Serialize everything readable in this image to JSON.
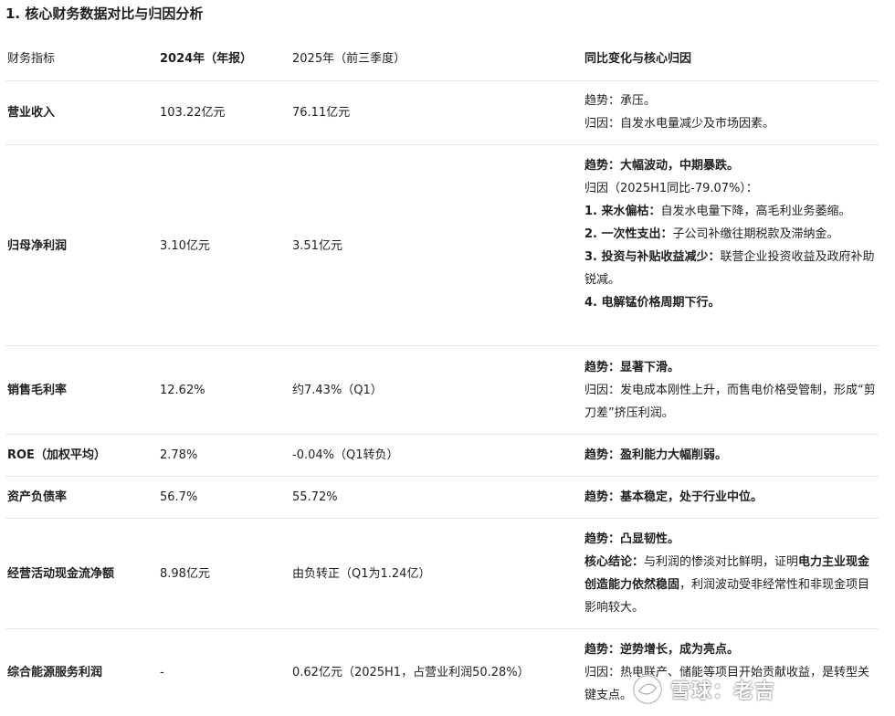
{
  "title": "1. 核心财务数据对比与归因分析",
  "headers": [
    "财务指标",
    "2024年（年报）",
    "2025年（前三季度）",
    "同比变化与核心归因"
  ],
  "rows": [
    {
      "metric": "营业收入",
      "y2024": "103.22亿元",
      "y2025": "76.11亿元",
      "analysis": [
        {
          "segments": [
            {
              "text": "趋势：承压。",
              "bold": false
            }
          ]
        },
        {
          "segments": [
            {
              "text": "归因：自发水电量减少及市场因素。",
              "bold": false
            }
          ]
        }
      ]
    },
    {
      "metric": "归母净利润",
      "y2024": "3.10亿元",
      "y2025": "3.51亿元",
      "analysis": [
        {
          "segments": [
            {
              "text": "趋势：大幅波动，中期暴跌。",
              "bold": true
            }
          ]
        },
        {
          "segments": [
            {
              "text": "归因（2025H1同比-79.07%）：",
              "bold": false
            }
          ]
        },
        {
          "segments": [
            {
              "text": "1. 来水偏枯：",
              "bold": true
            },
            {
              "text": "自发水电量下降，高毛利业务萎缩。",
              "bold": false
            }
          ]
        },
        {
          "segments": [
            {
              "text": "2. 一次性支出：",
              "bold": true
            },
            {
              "text": "子公司补缴往期税款及滞纳金。",
              "bold": false
            }
          ]
        },
        {
          "segments": [
            {
              "text": "3. 投资与补贴收益减少：",
              "bold": true
            },
            {
              "text": "联营企业投资收益及政府补助锐减。",
              "bold": false
            }
          ]
        },
        {
          "segments": [
            {
              "text": "4. 电解锰价格周期下行。",
              "bold": true
            }
          ]
        }
      ]
    },
    {
      "metric": "销售毛利率",
      "y2024": "12.62%",
      "y2025": "约7.43%（Q1）",
      "analysis": [
        {
          "segments": [
            {
              "text": "趋势：显著下滑。",
              "bold": true
            }
          ]
        },
        {
          "segments": [
            {
              "text": "归因：发电成本刚性上升，而售电价格受管制，形成“剪刀差”挤压利润。",
              "bold": false
            }
          ]
        }
      ]
    },
    {
      "metric": "ROE（加权平均）",
      "y2024": "2.78%",
      "y2025": "-0.04%（Q1转负）",
      "analysis": [
        {
          "segments": [
            {
              "text": "趋势：盈利能力大幅削弱。",
              "bold": true
            }
          ]
        }
      ]
    },
    {
      "metric": "资产负债率",
      "y2024": "56.7%",
      "y2025": "55.72%",
      "analysis": [
        {
          "segments": [
            {
              "text": "趋势：基本稳定，处于行业中位。",
              "bold": true
            }
          ]
        }
      ]
    },
    {
      "metric": "经营活动现金流净额",
      "y2024": "8.98亿元",
      "y2025": "由负转正（Q1为1.24亿）",
      "analysis": [
        {
          "segments": [
            {
              "text": "趋势：凸显韧性。",
              "bold": true
            }
          ]
        },
        {
          "segments": [
            {
              "text": "核心结论：",
              "bold": true
            },
            {
              "text": "与利润的惨淡对比鲜明，证明",
              "bold": false
            },
            {
              "text": "电力主业现金创造能力依然稳固",
              "bold": true
            },
            {
              "text": "，利润波动受非经常性和非现金项目影响较大。",
              "bold": false
            }
          ]
        }
      ]
    },
    {
      "metric": "综合能源服务利润",
      "y2024": "-",
      "y2025": "0.62亿元（2025H1，占营业利润50.28%）",
      "analysis": [
        {
          "segments": [
            {
              "text": "趋势：逆势增长，成为亮点。",
              "bold": true
            }
          ]
        },
        {
          "segments": [
            {
              "text": "归因：热电联产、储能等项目开始贡献收益，是转型关键支点。",
              "bold": false
            }
          ]
        }
      ]
    }
  ],
  "watermark": "雪球：老吉",
  "watermark_logo": "snowball-logo-icon"
}
